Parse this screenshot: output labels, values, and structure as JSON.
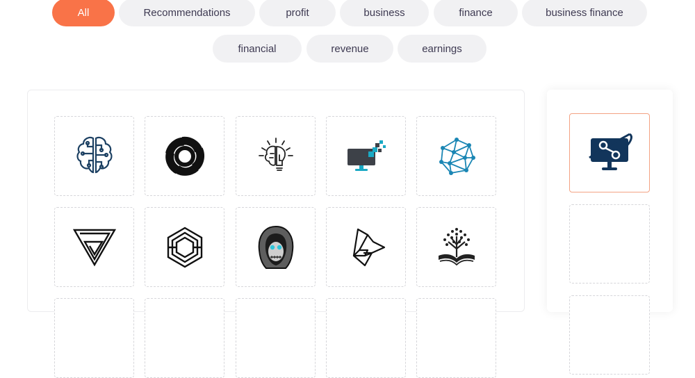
{
  "filters": {
    "tags": [
      {
        "label": "All",
        "active": true
      },
      {
        "label": "Recommendations",
        "active": false
      },
      {
        "label": "profit",
        "active": false
      },
      {
        "label": "business",
        "active": false
      },
      {
        "label": "finance",
        "active": false
      },
      {
        "label": "business finance",
        "active": false
      },
      {
        "label": "financial",
        "active": false
      },
      {
        "label": "revenue",
        "active": false
      },
      {
        "label": "earnings",
        "active": false
      }
    ],
    "active_color": "#f97348",
    "inactive_color": "#f1f1f3"
  },
  "gallery": {
    "logos": [
      {
        "icon": "circuit-brain-icon"
      },
      {
        "icon": "black-swirl-icon"
      },
      {
        "icon": "brain-bulb-icon"
      },
      {
        "icon": "monitor-pixels-icon"
      },
      {
        "icon": "geometric-network-sphere-icon"
      },
      {
        "icon": "impossible-triangle-icon"
      },
      {
        "icon": "hexagon-lines-icon"
      },
      {
        "icon": "hooded-skull-icon"
      },
      {
        "icon": "twisted-triangle-icon"
      },
      {
        "icon": "book-tree-icon"
      }
    ]
  },
  "sidebar": {
    "selected_logo": "monitor-orbit-icon",
    "selected_border_color": "#f3a283"
  }
}
